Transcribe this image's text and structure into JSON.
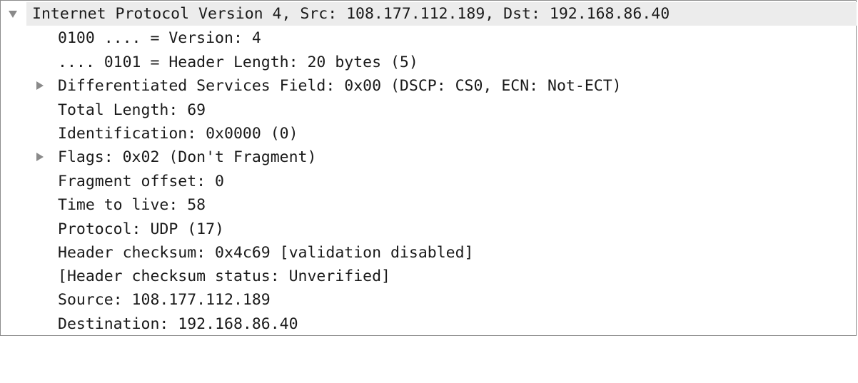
{
  "tree": {
    "root": {
      "label": "Internet Protocol Version 4, Src: 108.177.112.189, Dst: 192.168.86.40",
      "expanded": true,
      "icon": "triangle-down-icon"
    },
    "children": [
      {
        "label": "0100 .... = Version: 4",
        "expandable": false
      },
      {
        "label": ".... 0101 = Header Length: 20 bytes (5)",
        "expandable": false
      },
      {
        "label": "Differentiated Services Field: 0x00 (DSCP: CS0, ECN: Not-ECT)",
        "expandable": true,
        "icon": "triangle-right-icon"
      },
      {
        "label": "Total Length: 69",
        "expandable": false
      },
      {
        "label": "Identification: 0x0000 (0)",
        "expandable": false
      },
      {
        "label": "Flags: 0x02 (Don't Fragment)",
        "expandable": true,
        "icon": "triangle-right-icon"
      },
      {
        "label": "Fragment offset: 0",
        "expandable": false
      },
      {
        "label": "Time to live: 58",
        "expandable": false
      },
      {
        "label": "Protocol: UDP (17)",
        "expandable": false
      },
      {
        "label": "Header checksum: 0x4c69 [validation disabled]",
        "expandable": false
      },
      {
        "label": "[Header checksum status: Unverified]",
        "expandable": false
      },
      {
        "label": "Source: 108.177.112.189",
        "expandable": false
      },
      {
        "label": "Destination: 192.168.86.40",
        "expandable": false
      }
    ]
  },
  "colors": {
    "selected_row_bg": "#ececec",
    "disclosure_triangle": "#8a8a8a",
    "border": "#8c8c8c",
    "text": "#1a1a1a"
  }
}
